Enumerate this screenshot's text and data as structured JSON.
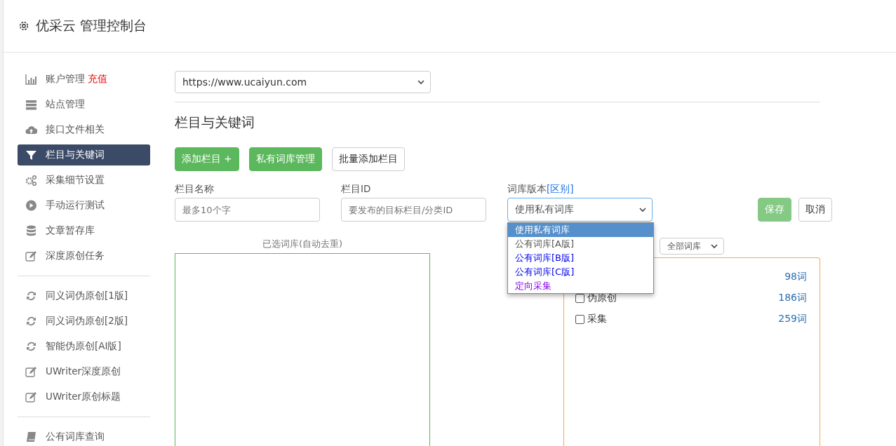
{
  "header": {
    "title": "优采云 管理控制台"
  },
  "sidebar": {
    "groups": [
      {
        "items": [
          {
            "label": "账户管理",
            "badge": "充值",
            "selected": false
          },
          {
            "label": "站点管理",
            "selected": false
          },
          {
            "label": "接口文件相关",
            "selected": false
          },
          {
            "label": "栏目与关键词",
            "selected": true
          },
          {
            "label": "采集细节设置",
            "selected": false
          },
          {
            "label": "手动运行测试",
            "selected": false
          },
          {
            "label": "文章暂存库",
            "selected": false
          },
          {
            "label": "深度原创任务",
            "selected": false
          }
        ]
      },
      {
        "items": [
          {
            "label": "同义词伪原创[1版]",
            "selected": false
          },
          {
            "label": "同义词伪原创[2版]",
            "selected": false
          },
          {
            "label": "智能伪原创[AI版]",
            "selected": false
          },
          {
            "label": "UWriter深度原创",
            "selected": false
          },
          {
            "label": "UWriter原创标题",
            "selected": false
          }
        ]
      },
      {
        "items": [
          {
            "label": "公有词库查询",
            "selected": false
          }
        ]
      }
    ]
  },
  "site_select": {
    "value": "https://www.ucaiyun.com"
  },
  "section_title": "栏目与关键词",
  "buttons": [
    {
      "label": "添加栏目 +",
      "kind": "primary"
    },
    {
      "label": "私有词库管理",
      "kind": "primary"
    },
    {
      "label": "批量添加栏目",
      "kind": "default"
    }
  ],
  "form": {
    "name_label": "栏目名称",
    "name_placeholder": "最多10个字",
    "id_label": "栏目ID",
    "id_placeholder": "要发布的目标栏目/分类ID",
    "version_label": "词库版本",
    "version_link": "[区别]",
    "version_value": "使用私有词库",
    "version_options": [
      {
        "label": "使用私有词库",
        "selected": true
      },
      {
        "label": "公有词库[A版]",
        "selected": false,
        "color": "#555555"
      },
      {
        "label": "公有词库[B版]",
        "selected": false,
        "color": "#0000ee"
      },
      {
        "label": "公有词库[C版]",
        "selected": false,
        "color": "#0000ee"
      },
      {
        "label": "定向采集",
        "selected": false,
        "color": "#8800ee"
      }
    ],
    "save": "保存",
    "cancel": "取消"
  },
  "selected_lib": {
    "title": "已选词库(自动去重)"
  },
  "all_lib": {
    "filter": "全部词库",
    "rows": [
      {
        "count": "98词"
      },
      {
        "label": "伪原创",
        "count": "186词",
        "checked": false
      },
      {
        "label": "采集",
        "count": "259词",
        "checked": false
      }
    ]
  }
}
